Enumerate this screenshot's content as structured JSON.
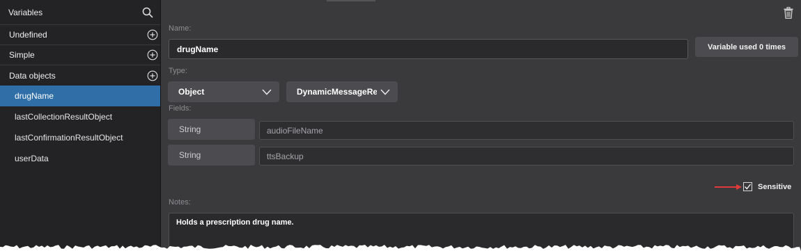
{
  "sidebar": {
    "title": "Variables",
    "search_icon": "search-icon",
    "groups": [
      {
        "label": "Undefined",
        "icon": "plus-circle-icon"
      },
      {
        "label": "Simple",
        "icon": "plus-circle-icon"
      },
      {
        "label": "Data objects",
        "icon": "plus-circle-icon"
      }
    ],
    "items": [
      {
        "label": "drugName",
        "selected": true
      },
      {
        "label": "lastCollectionResultObject"
      },
      {
        "label": "lastConfirmationResultObject"
      },
      {
        "label": "userData"
      }
    ]
  },
  "editor": {
    "delete_icon": "trash-icon",
    "name_label": "Name:",
    "name_value": "drugName",
    "usage_button": "Variable used 0 times",
    "type_label": "Type:",
    "type_value": "Object",
    "subtype_value": "DynamicMessageRef",
    "fields_label": "Fields:",
    "fields": [
      {
        "type": "String",
        "name": "audioFileName"
      },
      {
        "type": "String",
        "name": "ttsBackup"
      }
    ],
    "sensitive_label": "Sensitive",
    "sensitive_checked": true,
    "notes_label": "Notes:",
    "notes_value": "Holds a prescription drug name."
  },
  "colors": {
    "selected_item": "#2f6ea7",
    "arrow": "#e03a3a",
    "panel_bg": "#3a3a3d",
    "sidebar_bg": "#232325"
  }
}
